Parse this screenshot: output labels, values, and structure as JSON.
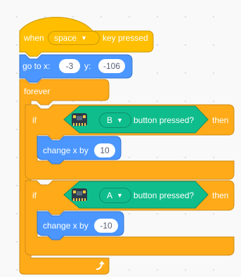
{
  "hat_block": {
    "when_label": "when",
    "key_value": "space",
    "key_pressed_label": "key pressed"
  },
  "goto_block": {
    "label": "go to x:",
    "x_value": "-3",
    "y_label": "y:",
    "y_value": "-106"
  },
  "forever_block": {
    "label": "forever"
  },
  "if_block_1": {
    "if_label": "if",
    "button_value": "B",
    "sensor_label": "button pressed?",
    "then_label": "then",
    "change_label": "change x by",
    "change_value": "10"
  },
  "if_block_2": {
    "if_label": "if",
    "button_value": "A",
    "sensor_label": "button pressed?",
    "then_label": "then",
    "change_label": "change x by",
    "change_value": "-10"
  },
  "icons": {
    "loop": "loop-arrow-icon",
    "microbit": "microbit-icon",
    "dropdown": "caret-down-icon"
  },
  "colors": {
    "events": "#ffbf00",
    "events_border": "#cc9900",
    "motion": "#4c97ff",
    "motion_border": "#3373cc",
    "control": "#ffab19",
    "control_border": "#cf8b17",
    "extension": "#0fbd8c",
    "extension_border": "#0b8e69"
  }
}
